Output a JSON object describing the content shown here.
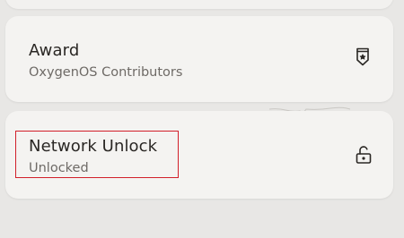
{
  "items": [
    {
      "title": "Award",
      "subtitle": "OxygenOS Contributors",
      "icon": "award-badge-icon"
    },
    {
      "title": "Network Unlock",
      "subtitle": "Unlocked",
      "icon": "unlocked-padlock-icon"
    }
  ],
  "colors": {
    "background": "#e8e7e5",
    "card": "#f4f3f1",
    "title_text": "#2a2724",
    "subtitle_text": "#6e6a66",
    "highlight_border": "#d21f2a"
  }
}
